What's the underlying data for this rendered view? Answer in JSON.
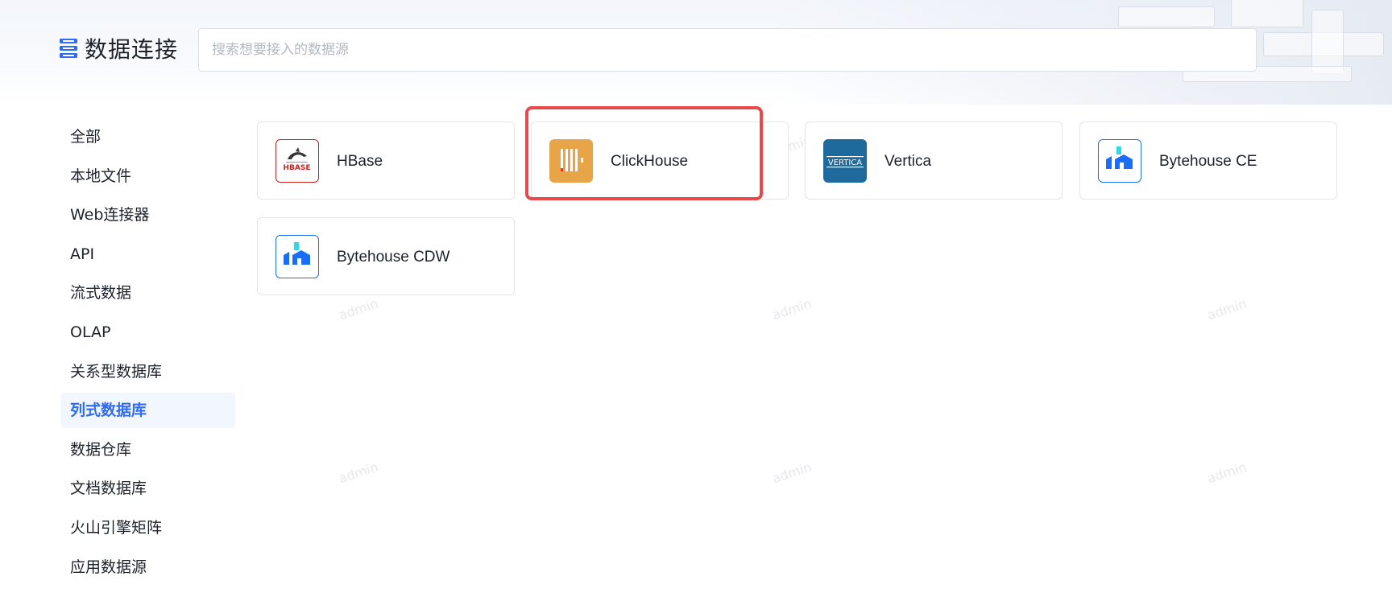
{
  "header": {
    "title": "数据连接",
    "search": {
      "placeholder": "搜索想要接入的数据源",
      "value": ""
    }
  },
  "sidebar": {
    "items": [
      {
        "label": "全部",
        "active": false
      },
      {
        "label": "本地文件",
        "active": false
      },
      {
        "label": "Web连接器",
        "active": false
      },
      {
        "label": "API",
        "active": false
      },
      {
        "label": "流式数据",
        "active": false
      },
      {
        "label": "OLAP",
        "active": false
      },
      {
        "label": "关系型数据库",
        "active": false
      },
      {
        "label": "列式数据库",
        "active": true
      },
      {
        "label": "数据仓库",
        "active": false
      },
      {
        "label": "文档数据库",
        "active": false
      },
      {
        "label": "火山引擎矩阵",
        "active": false
      },
      {
        "label": "应用数据源",
        "active": false
      }
    ]
  },
  "cards": [
    {
      "label": "HBase",
      "icon": "hbase-logo-icon"
    },
    {
      "label": "ClickHouse",
      "icon": "clickhouse-logo-icon"
    },
    {
      "label": "Vertica",
      "icon": "vertica-logo-icon"
    },
    {
      "label": "Bytehouse CE",
      "icon": "bytehouse-logo-icon"
    },
    {
      "label": "Bytehouse CDW",
      "icon": "bytehouse-logo-icon"
    }
  ],
  "icons": {
    "hbase_text": "HBASE",
    "vertica_text": "VERTICA"
  },
  "watermark_text": "admin",
  "colors": {
    "accent": "#2f6bf0",
    "active_bg": "#f2f6fe",
    "highlight": "#e8494a",
    "clickhouse": "#e8a547",
    "vertica": "#1e6a9c",
    "hbase": "#cc1f1f",
    "bytehouse_blue": "#1a6ef5",
    "bytehouse_cyan": "#2fd8e6"
  }
}
